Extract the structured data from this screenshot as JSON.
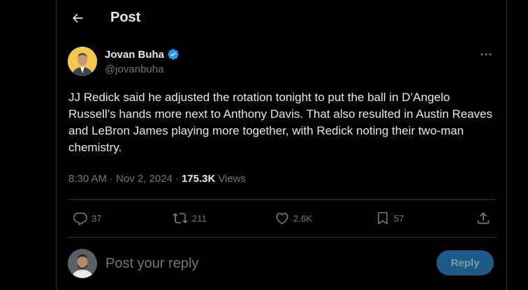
{
  "header": {
    "title": "Post"
  },
  "author": {
    "name": "Jovan Buha",
    "handle": "@jovanbuha"
  },
  "post": {
    "text": "JJ Redick said he adjusted the rotation tonight to put the ball in D’Angelo Russell’s hands more next to Anthony Davis. That also resulted in Austin Reaves and LeBron James playing more together, with Redick noting their two-man chemistry.",
    "time": "8:30 AM",
    "date": "Nov 2, 2024",
    "views_count": "175.3K",
    "views_label": "Views"
  },
  "actions": {
    "replies": "37",
    "reposts": "211",
    "likes": "2.6K",
    "bookmarks": "57"
  },
  "reply": {
    "placeholder": "Post your reply",
    "button": "Reply"
  },
  "colors": {
    "background": "#000000",
    "text": "#e7e9ea",
    "muted": "#71767b",
    "verified": "#1d9bf0",
    "reply_button": "#1a5a84"
  }
}
